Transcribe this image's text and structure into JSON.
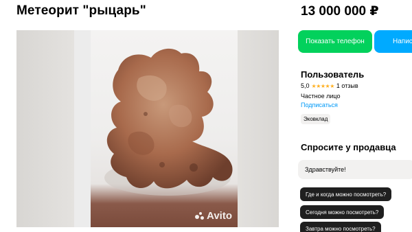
{
  "listing": {
    "title": "Метеорит \"рыцарь\"",
    "price": "13 000 000 ₽"
  },
  "gallery": {
    "watermark": "Avito",
    "image_subject": "reddish-brown rock (meteorite) on white background"
  },
  "actions": {
    "show_phone_label": "Показать телефон",
    "write_label": "Напис"
  },
  "seller": {
    "name": "Пользователь",
    "rating": "5,0",
    "stars": "★★★★★",
    "reviews": "1 отзыв",
    "type": "Частное лицо",
    "subscribe_label": "Подписаться",
    "tag": "Эковклад"
  },
  "ask_seller": {
    "title": "Спросите у продавца",
    "input_value": "Здравствуйте!",
    "quick_questions": [
      "Где и когда можно посмотреть?",
      "Сегодня можно посмотреть?",
      "Завтра можно посмотреть?"
    ]
  },
  "colors": {
    "green_button": "#02d15c",
    "blue_button": "#00aaff",
    "link": "#0099f7",
    "star": "#ffb021",
    "chip_bg": "#1f1f1f"
  }
}
